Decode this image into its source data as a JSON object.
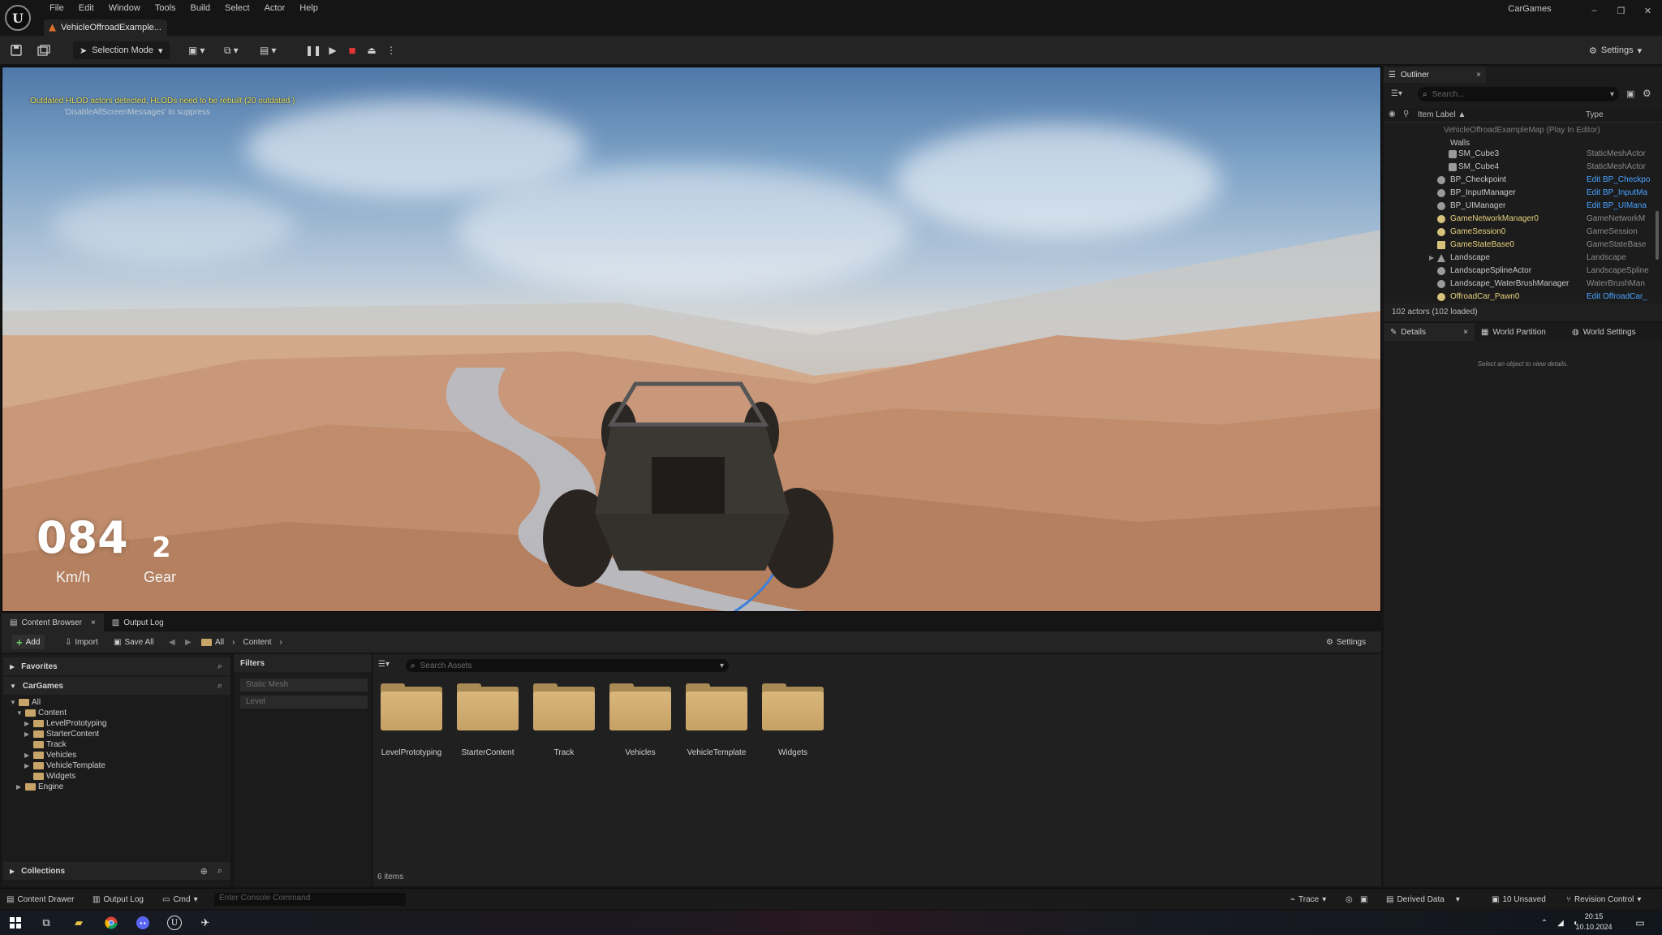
{
  "app": {
    "logo": "U",
    "menu": [
      "File",
      "Edit",
      "Window",
      "Tools",
      "Build",
      "Select",
      "Actor",
      "Help"
    ],
    "document_tab": "VehicleOffroadExample...",
    "project_name": "CarGames",
    "window_controls": {
      "minimize": "–",
      "restore": "❐",
      "close": "✕"
    }
  },
  "toolbar": {
    "selection_mode": "Selection Mode",
    "settings_label": "Settings"
  },
  "viewport": {
    "warning": "Outdated HLOD actors detected, HLODs need to be rebuilt (20 outdated )",
    "suppress_hint": "'DisableAllScreenMessages' to suppress",
    "hud": {
      "speed": "084",
      "speed_unit": "Km/h",
      "gear": "2",
      "gear_label": "Gear"
    }
  },
  "outliner": {
    "tab_label": "Outliner",
    "close": "×",
    "search_placeholder": "Search...",
    "col_label": "Item Label ▲",
    "col_type": "Type",
    "rows": [
      {
        "label": "VehicleOffroadExampleMap (Play In Editor)",
        "type": ""
      },
      {
        "label": "Walls",
        "type": ""
      },
      {
        "label": "SM_Cube3",
        "type": "StaticMeshActor"
      },
      {
        "label": "SM_Cube4",
        "type": "StaticMeshActor"
      },
      {
        "label": "BP_Checkpoint",
        "type": "Edit BP_Checkpo"
      },
      {
        "label": "BP_InputManager",
        "type": "Edit BP_InputMa"
      },
      {
        "label": "BP_UIManager",
        "type": "Edit BP_UIMana"
      },
      {
        "label": "GameNetworkManager0",
        "type": "GameNetworkM"
      },
      {
        "label": "GameSession0",
        "type": "GameSession"
      },
      {
        "label": "GameStateBase0",
        "type": "GameStateBase"
      },
      {
        "label": "Landscape",
        "type": "Landscape"
      },
      {
        "label": "LandscapeSplineActor",
        "type": "LandscapeSpline"
      },
      {
        "label": "Landscape_WaterBrushManager",
        "type": "WaterBrushMan"
      },
      {
        "label": "OffroadCar_Pawn0",
        "type": "Edit OffroadCar_"
      }
    ],
    "footer": "102 actors (102 loaded)"
  },
  "details": {
    "tabs": [
      "Details",
      "World Partition",
      "World Settings"
    ],
    "close": "×",
    "empty_message": "Select an object to view details."
  },
  "content_browser": {
    "tabs": [
      "Content Browser",
      "Output Log"
    ],
    "close": "×",
    "toolbar": {
      "add": "Add",
      "import": "Import",
      "save_all": "Save All",
      "crumb_all": "All",
      "crumb_content": "Content",
      "settings": "Settings"
    },
    "favorites": "Favorites",
    "project": "CarGames",
    "tree": [
      {
        "label": "All",
        "depth": 0
      },
      {
        "label": "Content",
        "depth": 1
      },
      {
        "label": "LevelPrototyping",
        "depth": 2
      },
      {
        "label": "StarterContent",
        "depth": 2
      },
      {
        "label": "Track",
        "depth": 2
      },
      {
        "label": "Vehicles",
        "depth": 2
      },
      {
        "label": "VehicleTemplate",
        "depth": 2
      },
      {
        "label": "Widgets",
        "depth": 2
      },
      {
        "label": "Engine",
        "depth": 1
      }
    ],
    "collections": "Collections",
    "filters_title": "Filters",
    "filters": [
      "Static Mesh",
      "Level"
    ],
    "search_placeholder": "Search Assets",
    "assets": [
      "LevelPrototyping",
      "StarterContent",
      "Track",
      "Vehicles",
      "VehicleTemplate",
      "Widgets"
    ],
    "items_count": "6 items"
  },
  "statusbar": {
    "content_drawer": "Content Drawer",
    "output_log": "Output Log",
    "cmd": "Cmd",
    "console_placeholder": "Enter Console Command",
    "trace": "Trace",
    "derived_data": "Derived Data",
    "unsaved": "10 Unsaved",
    "revision_control": "Revision Control"
  },
  "taskbar": {
    "time": "20:15",
    "date": "10.10.2024"
  }
}
